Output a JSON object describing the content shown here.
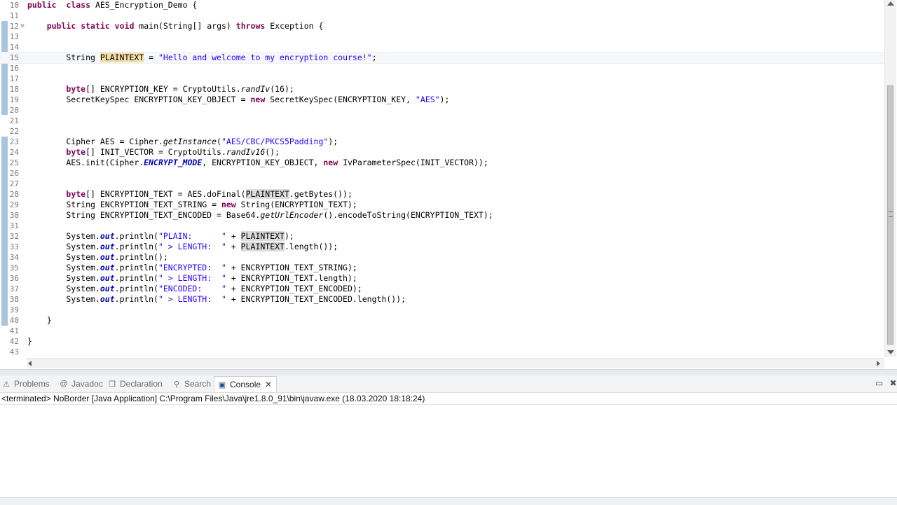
{
  "editor": {
    "lines": [
      {
        "n": "10",
        "fold": "",
        "segs": [
          [
            "kw",
            "public"
          ],
          [
            "",
            "  "
          ],
          [
            "kw",
            "class"
          ],
          [
            "",
            " AES_Encryption_Demo {"
          ]
        ]
      },
      {
        "n": "11",
        "fold": "",
        "segs": []
      },
      {
        "n": "12",
        "fold": "⊖",
        "segs": [
          [
            "",
            "    "
          ],
          [
            "kw",
            "public"
          ],
          [
            "",
            " "
          ],
          [
            "kw",
            "static"
          ],
          [
            "",
            " "
          ],
          [
            "kw",
            "void"
          ],
          [
            "",
            " main(String[] args) "
          ],
          [
            "kw",
            "throws"
          ],
          [
            "",
            " Exception {"
          ]
        ]
      },
      {
        "n": "13",
        "fold": "",
        "segs": []
      },
      {
        "n": "14",
        "fold": "",
        "segs": []
      },
      {
        "n": "15",
        "fold": "",
        "current": true,
        "segs": [
          [
            "",
            "        String "
          ],
          [
            "occ-w",
            "PLAINT"
          ],
          [
            "caret",
            ""
          ],
          [
            "occ-w",
            "EXT"
          ],
          [
            "",
            " = "
          ],
          [
            "str",
            "\"Hello and welcome to my encryption course!\""
          ],
          [
            "",
            ";"
          ]
        ]
      },
      {
        "n": "16",
        "fold": "",
        "segs": []
      },
      {
        "n": "17",
        "fold": "",
        "segs": []
      },
      {
        "n": "18",
        "fold": "",
        "segs": [
          [
            "",
            "        "
          ],
          [
            "kw",
            "byte"
          ],
          [
            "",
            "[] ENCRYPTION_KEY = CryptoUtils."
          ],
          [
            "ital",
            "randIv"
          ],
          [
            "",
            "(16);"
          ]
        ]
      },
      {
        "n": "19",
        "fold": "",
        "segs": [
          [
            "",
            "        SecretKeySpec ENCRYPTION_KEY_OBJECT = "
          ],
          [
            "kw",
            "new"
          ],
          [
            "",
            " SecretKeySpec(ENCRYPTION_KEY, "
          ],
          [
            "str",
            "\"AES\""
          ],
          [
            "",
            ");"
          ]
        ]
      },
      {
        "n": "20",
        "fold": "",
        "segs": []
      },
      {
        "n": "21",
        "fold": "",
        "segs": []
      },
      {
        "n": "22",
        "fold": "",
        "segs": []
      },
      {
        "n": "23",
        "fold": "",
        "segs": [
          [
            "",
            "        Cipher AES = Cipher."
          ],
          [
            "ital",
            "getInstance"
          ],
          [
            "",
            "("
          ],
          [
            "str",
            "\"AES/CBC/PKCS5Padding\""
          ],
          [
            "",
            ");"
          ]
        ]
      },
      {
        "n": "24",
        "fold": "",
        "segs": [
          [
            "",
            "        "
          ],
          [
            "kw",
            "byte"
          ],
          [
            "",
            "[] INIT_VECTOR = CryptoUtils."
          ],
          [
            "ital",
            "randIv16"
          ],
          [
            "",
            "();"
          ]
        ]
      },
      {
        "n": "25",
        "fold": "",
        "segs": [
          [
            "",
            "        AES.init(Cipher."
          ],
          [
            "sf",
            "ENCRYPT_MODE"
          ],
          [
            "",
            ", ENCRYPTION_KEY_OBJECT, "
          ],
          [
            "kw",
            "new"
          ],
          [
            "",
            " IvParameterSpec(INIT_VECTOR));"
          ]
        ]
      },
      {
        "n": "26",
        "fold": "",
        "segs": []
      },
      {
        "n": "27",
        "fold": "",
        "segs": []
      },
      {
        "n": "28",
        "fold": "",
        "segs": [
          [
            "",
            "        "
          ],
          [
            "kw",
            "byte"
          ],
          [
            "",
            "[] ENCRYPTION_TEXT = AES.doFinal("
          ],
          [
            "occ-r",
            "PLAINTEXT"
          ],
          [
            "",
            ".getBytes());"
          ]
        ]
      },
      {
        "n": "29",
        "fold": "",
        "segs": [
          [
            "",
            "        String ENCRYPTION_TEXT_STRING = "
          ],
          [
            "kw",
            "new"
          ],
          [
            "",
            " String(ENCRYPTION_TEXT);"
          ]
        ]
      },
      {
        "n": "30",
        "fold": "",
        "segs": [
          [
            "",
            "        String ENCRYPTION_TEXT_ENCODED = Base64."
          ],
          [
            "ital",
            "getUrlEncoder"
          ],
          [
            "",
            "().encodeToString(ENCRYPTION_TEXT);"
          ]
        ]
      },
      {
        "n": "31",
        "fold": "",
        "segs": []
      },
      {
        "n": "32",
        "fold": "",
        "segs": [
          [
            "",
            "        System."
          ],
          [
            "sf",
            "out"
          ],
          [
            "",
            ".println("
          ],
          [
            "str",
            "\"PLAIN:      \""
          ],
          [
            "",
            " + "
          ],
          [
            "occ-r",
            "PLAINTEXT"
          ],
          [
            "",
            ");"
          ]
        ]
      },
      {
        "n": "33",
        "fold": "",
        "segs": [
          [
            "",
            "        System."
          ],
          [
            "sf",
            "out"
          ],
          [
            "",
            ".println("
          ],
          [
            "str",
            "\" > LENGTH:  \""
          ],
          [
            "",
            " + "
          ],
          [
            "occ-r",
            "PLAINTEXT"
          ],
          [
            "",
            ".length());"
          ]
        ]
      },
      {
        "n": "34",
        "fold": "",
        "segs": [
          [
            "",
            "        System."
          ],
          [
            "sf",
            "out"
          ],
          [
            "",
            ".println();"
          ]
        ]
      },
      {
        "n": "35",
        "fold": "",
        "segs": [
          [
            "",
            "        System."
          ],
          [
            "sf",
            "out"
          ],
          [
            "",
            ".println("
          ],
          [
            "str",
            "\"ENCRYPTED:  \""
          ],
          [
            "",
            " + ENCRYPTION_TEXT_STRING);"
          ]
        ]
      },
      {
        "n": "36",
        "fold": "",
        "segs": [
          [
            "",
            "        System."
          ],
          [
            "sf",
            "out"
          ],
          [
            "",
            ".println("
          ],
          [
            "str",
            "\" > LENGTH:  \""
          ],
          [
            "",
            " + ENCRYPTION_TEXT.length);"
          ]
        ]
      },
      {
        "n": "37",
        "fold": "",
        "segs": [
          [
            "",
            "        System."
          ],
          [
            "sf",
            "out"
          ],
          [
            "",
            ".println("
          ],
          [
            "str",
            "\"ENCODED:    \""
          ],
          [
            "",
            " + ENCRYPTION_TEXT_ENCODED);"
          ]
        ]
      },
      {
        "n": "38",
        "fold": "",
        "segs": [
          [
            "",
            "        System."
          ],
          [
            "sf",
            "out"
          ],
          [
            "",
            ".println("
          ],
          [
            "str",
            "\" > LENGTH:  \""
          ],
          [
            "",
            " + ENCRYPTION_TEXT_ENCODED.length());"
          ]
        ]
      },
      {
        "n": "39",
        "fold": "",
        "segs": []
      },
      {
        "n": "40",
        "fold": "",
        "segs": [
          [
            "",
            "    }"
          ]
        ]
      },
      {
        "n": "41",
        "fold": "",
        "segs": []
      },
      {
        "n": "42",
        "fold": "",
        "segs": [
          [
            "",
            "}"
          ]
        ]
      },
      {
        "n": "43",
        "fold": "",
        "segs": []
      }
    ]
  },
  "panel": {
    "tabs": [
      {
        "id": "problems",
        "label": "Problems",
        "icon": "problems-icon",
        "glyph": "⚠"
      },
      {
        "id": "javadoc",
        "label": "Javadoc",
        "icon": "javadoc-icon",
        "glyph": "@"
      },
      {
        "id": "declaration",
        "label": "Declaration",
        "icon": "declaration-icon",
        "glyph": "❐"
      },
      {
        "id": "search",
        "label": "Search",
        "icon": "search-icon",
        "glyph": "⚲"
      },
      {
        "id": "console",
        "label": "Console",
        "icon": "console-icon",
        "glyph": "▣",
        "active": true
      }
    ],
    "console_status": "<terminated> NoBorder [Java Application] C:\\Program Files\\Java\\jre1.8.0_91\\bin\\javaw.exe (18.03.2020 18:18:24)"
  },
  "colors": {
    "keyword": "#7f0055",
    "string": "#2a00ff",
    "static_field": "#0000c0",
    "write_occurrence": "#f5dfa8",
    "read_occurrence": "#dcdcdc"
  }
}
